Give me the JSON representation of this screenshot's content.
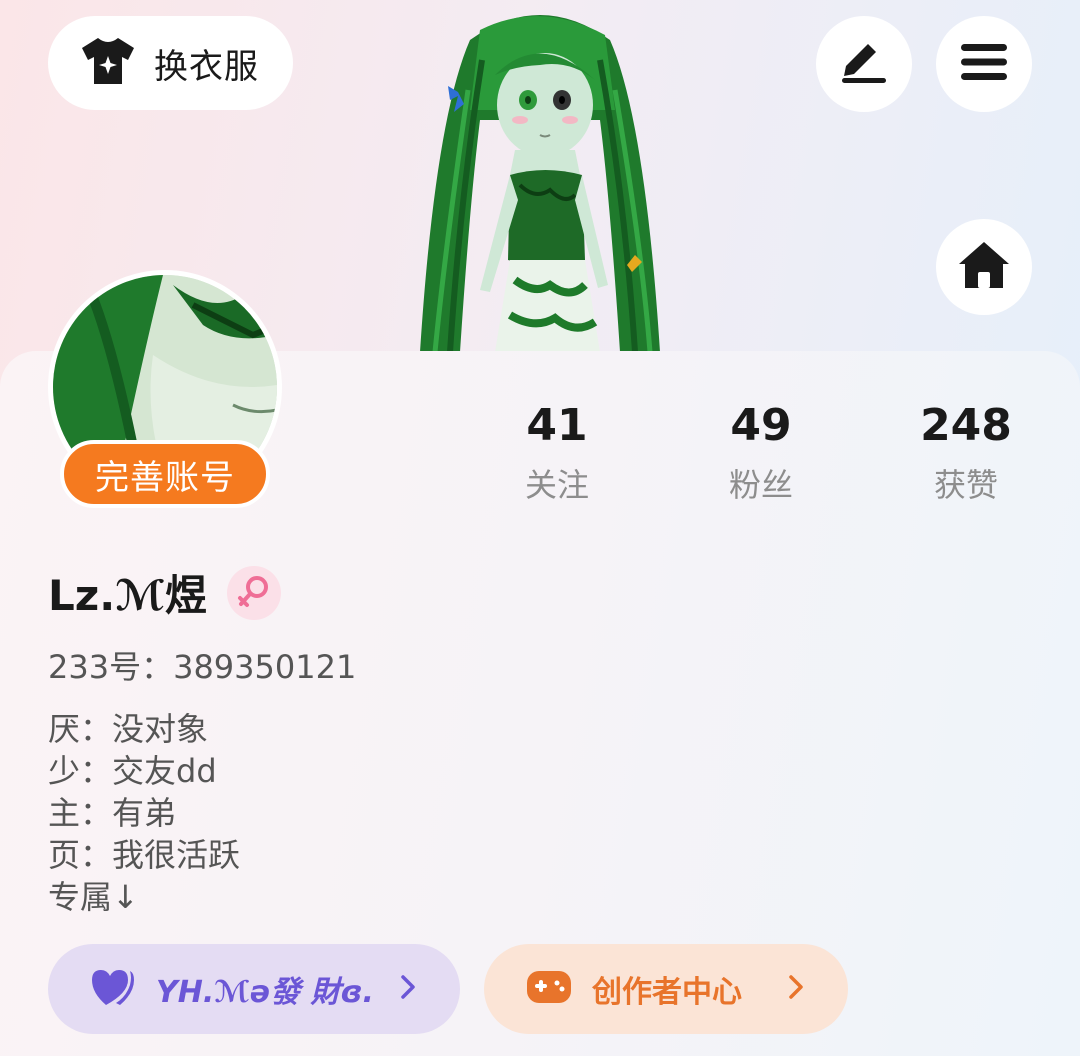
{
  "header": {
    "outfit_label": "换衣服",
    "edit_icon": "edit-icon",
    "menu_icon": "menu-icon",
    "home_icon": "home-icon"
  },
  "profile": {
    "complete_badge": "完善账号",
    "name": "Lz.ℳ煜",
    "gender_icon": "female-icon",
    "uid": "233号：389350121",
    "bio": [
      "厌：没对象",
      "少：交友dd",
      "主：有弟",
      "页：我很活跃",
      "专属↓"
    ]
  },
  "stats": [
    {
      "value": "41",
      "label": "关注"
    },
    {
      "value": "49",
      "label": "粉丝"
    },
    {
      "value": "248",
      "label": "获赞"
    }
  ],
  "buttons": {
    "group_label": "YH.ℳə發 財ɞ.",
    "creator_label": "创作者中心"
  },
  "colors": {
    "accent_orange": "#f57a1f",
    "purple_text": "#6b56d6",
    "orange_text": "#e8742b"
  }
}
